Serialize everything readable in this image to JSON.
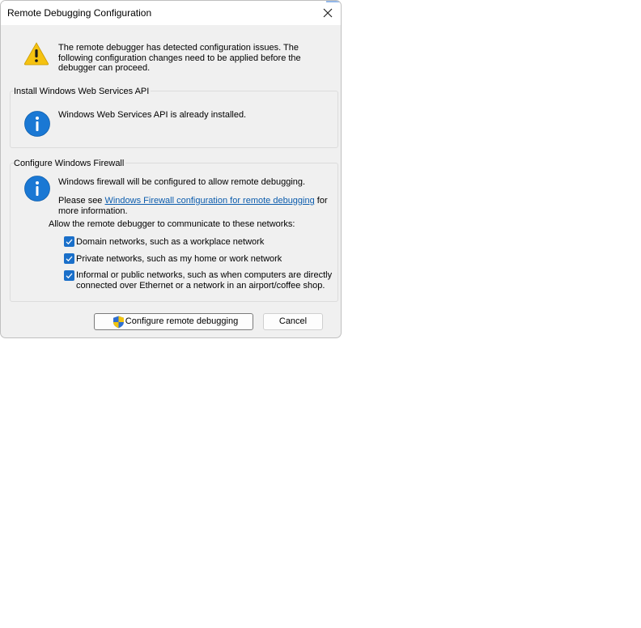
{
  "dialog": {
    "title": "Remote Debugging Configuration",
    "warning_line1": "The remote debugger has detected configuration issues. The",
    "warning_line2": "following configuration changes need to be applied before the",
    "warning_line3": "debugger can proceed."
  },
  "webservices": {
    "group_label": "Install Windows Web Services API",
    "message": "Windows Web Services API is already installed."
  },
  "firewall": {
    "group_label": "Configure Windows Firewall",
    "message": "Windows firewall will be configured to allow remote debugging.",
    "see_prefix": "Please see ",
    "link_text": "Windows Firewall configuration for remote debugging",
    "see_suffix": " for",
    "more_info": "more information.",
    "networks_prompt": "Allow the remote debugger to communicate to these networks:",
    "checkboxes": [
      {
        "line1": "Domain networks, such as a workplace network",
        "line2": "",
        "checked": true
      },
      {
        "line1": "Private networks, such as my home or work network",
        "line2": "",
        "checked": true
      },
      {
        "line1": "Informal or public networks, such as when computers are directly",
        "line2": "connected over Ethernet or a network in an airport/coffee shop.",
        "checked": true
      }
    ]
  },
  "buttons": {
    "configure": "Configure remote debugging",
    "cancel": "Cancel"
  },
  "colors": {
    "accent": "#1a6fc9",
    "link": "#0b5cad",
    "warning": "#f5c211",
    "info": "#1a78d4"
  },
  "icons": {
    "warning": "warning-icon",
    "info": "info-icon",
    "shield": "uac-shield-icon",
    "close": "close-icon",
    "check": "checkmark-icon"
  }
}
